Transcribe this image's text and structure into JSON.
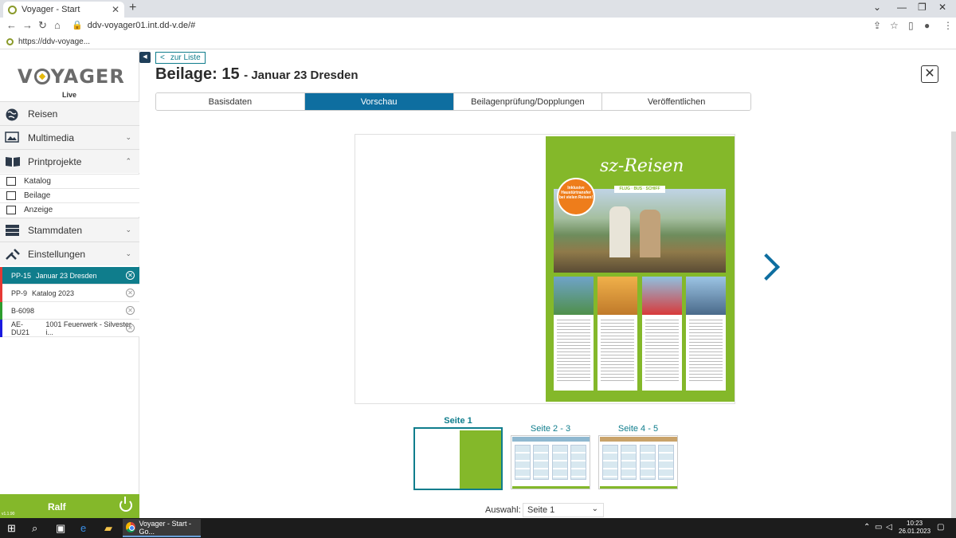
{
  "browser": {
    "tab_title": "Voyager - Start",
    "url": "ddv-voyager01.int.dd-v.de/#",
    "bookmark": "https://ddv-voyage..."
  },
  "sidebar": {
    "logo": "VOYAGER",
    "logo_sub": "Live",
    "menu": [
      {
        "label": "Reisen"
      },
      {
        "label": "Multimedia"
      },
      {
        "label": "Printprojekte"
      },
      {
        "label": "Stammdaten"
      },
      {
        "label": "Einstellungen"
      }
    ],
    "sub_items": [
      {
        "label": "Katalog"
      },
      {
        "label": "Beilage"
      },
      {
        "label": "Anzeige"
      }
    ],
    "open_items": [
      {
        "code": "PP-15",
        "label": "Januar 23 Dresden",
        "color": "#e53935"
      },
      {
        "code": "PP-9",
        "label": "Katalog 2023",
        "color": "#e53935"
      },
      {
        "code": "B-6098",
        "label": "",
        "color": "#2e9d2e"
      },
      {
        "code": "AE-DU21",
        "label": "1001 Feuerwerk - Silvester i...",
        "color": "#1a1ae0"
      }
    ],
    "user": "Ralf",
    "version": "v1.1.90"
  },
  "main": {
    "back_label": "zur Liste",
    "title": "Beilage: 15",
    "subtitle": "- Januar 23 Dresden",
    "tabs": [
      {
        "label": "Basisdaten"
      },
      {
        "label": "Vorschau"
      },
      {
        "label": "Beilagenprüfung/Dopplungen"
      },
      {
        "label": "Veröffentlichen"
      }
    ],
    "active_tab": "Vorschau",
    "cover": {
      "brand": "sz-Reisen",
      "strip": "FLUG · BUS · SCHIFF",
      "stamp": "Inklusive Haustürtransfer bei vielen Reisen!"
    },
    "thumbnails": [
      {
        "label": "Seite 1",
        "selected": true
      },
      {
        "label": "Seite 2 - 3",
        "selected": false
      },
      {
        "label": "Seite 4 - 5",
        "selected": false
      }
    ],
    "auswahl_label": "Auswahl:",
    "auswahl_value": "Seite 1"
  },
  "taskbar": {
    "app_label": "Voyager - Start - Go...",
    "time": "10:23",
    "date": "26.01.2023"
  },
  "colors": {
    "accent": "#0e6ea0",
    "teal": "#0f7d8c",
    "green": "#84b82a"
  }
}
